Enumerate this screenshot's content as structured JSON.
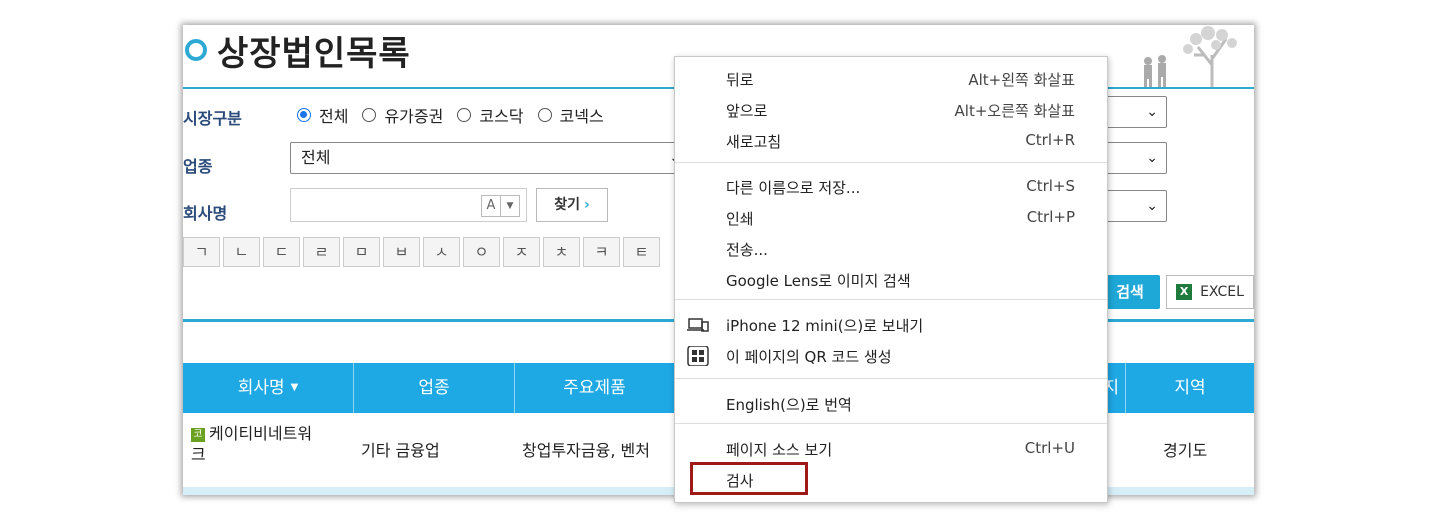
{
  "page": {
    "title": "상장법인목록",
    "market_label": "시장구분",
    "market_options": [
      {
        "label": "전체",
        "checked": true
      },
      {
        "label": "유가증권",
        "checked": false
      },
      {
        "label": "코스닥",
        "checked": false
      },
      {
        "label": "코넥스",
        "checked": false
      }
    ],
    "industry_label": "업종",
    "industry_select": "전체",
    "company_label": "회사명",
    "company_input_value": "",
    "ime_toggle": "A",
    "find_button": "찾기",
    "chosung": [
      "ㄱ",
      "ㄴ",
      "ㄷ",
      "ㄹ",
      "ㅁ",
      "ㅂ",
      "ㅅ",
      "ㅇ",
      "ㅈ",
      "ㅊ",
      "ㅋ",
      "ㅌ"
    ],
    "search_button": "검색",
    "excel_button": "EXCEL",
    "table": {
      "headers": [
        "회사명",
        "업종",
        "주요제품",
        "지",
        "지역"
      ],
      "rows": [
        {
          "badge": "코",
          "company": "케이티비네트워크",
          "company_line1": "케이티비네트워",
          "company_line2": "크",
          "industry": "기타 금융업",
          "product": "창업투자금융, 벤처",
          "region": "경기도"
        }
      ]
    }
  },
  "context_menu": {
    "items": [
      {
        "label": "뒤로",
        "shortcut": "Alt+왼쪽 화살표"
      },
      {
        "label": "앞으로",
        "shortcut": "Alt+오른쪽 화살표"
      },
      {
        "label": "새로고침",
        "shortcut": "Ctrl+R"
      },
      {
        "label": "다른 이름으로 저장...",
        "shortcut": "Ctrl+S"
      },
      {
        "label": "인쇄",
        "shortcut": "Ctrl+P"
      },
      {
        "label": "전송...",
        "shortcut": ""
      },
      {
        "label": "Google Lens로 이미지 검색",
        "shortcut": ""
      },
      {
        "label": "iPhone 12 mini(으)로 보내기",
        "shortcut": "",
        "icon": "devices-icon"
      },
      {
        "label": "이 페이지의 QR 코드 생성",
        "shortcut": "",
        "icon": "qr-code-icon"
      },
      {
        "label": "English(으)로 번역",
        "shortcut": ""
      },
      {
        "label": "페이지 소스 보기",
        "shortcut": "Ctrl+U"
      },
      {
        "label": "검사",
        "shortcut": ""
      }
    ]
  },
  "colors": {
    "accent": "#1ea8e4",
    "highlight_box": "#a01919"
  }
}
